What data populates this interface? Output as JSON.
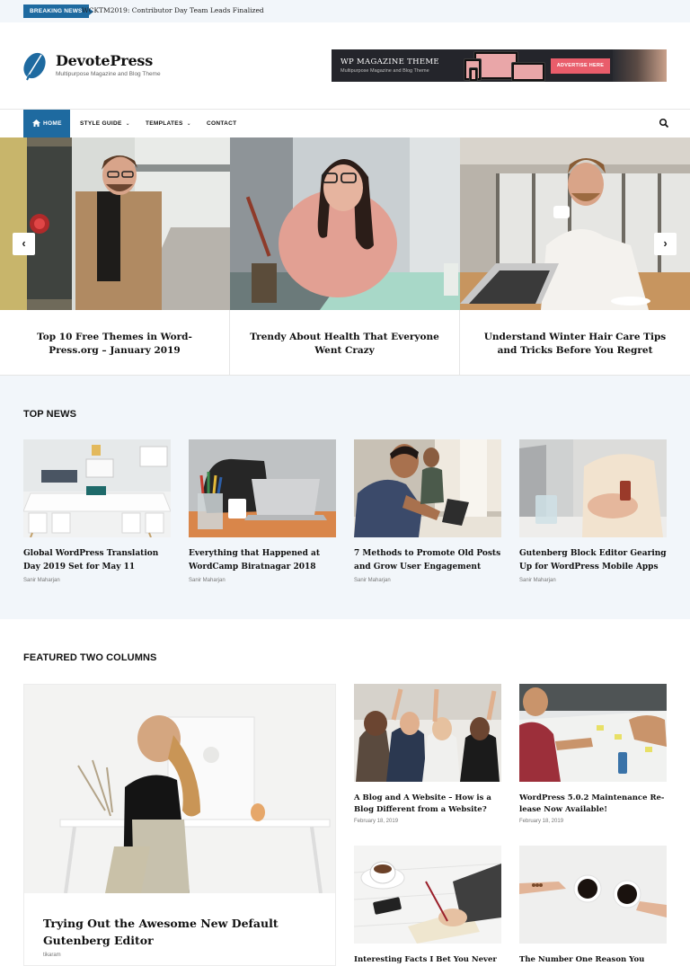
{
  "breaking": {
    "badge": "BREAKING NEWS",
    "text": "WCKTM2019: Contributor Day Team Leads Finalized"
  },
  "site": {
    "title": "DevotePress",
    "tagline": "Multipurpose Magazine and Blog Theme"
  },
  "ad": {
    "title": "WP MAGAZINE THEME",
    "subtitle": "Multipurpose Magazine and Blog Theme",
    "button": "ADVERTISE HERE"
  },
  "nav": {
    "home": "HOME",
    "style_guide": "STYLE GUIDE",
    "templates": "TEMPLATES",
    "contact": "CONTACT",
    "dropdown_glyph": "⌄"
  },
  "slider": {
    "prev": "‹",
    "next": "›",
    "slides": [
      {
        "title": "Top 10 Free Themes in Word-Press.org – January 2019"
      },
      {
        "title": "Trendy About Health That Everyone Went Crazy"
      },
      {
        "title": "Understand Winter Hair Care Tips and Tricks Before You Regret"
      }
    ]
  },
  "top_news": {
    "heading": "TOP NEWS",
    "items": [
      {
        "title": "Global WordPress Translation Day 2019 Set for May 11",
        "author": "Sanir Maharjan"
      },
      {
        "title": "Everything that Happened at WordCamp Biratnagar 2018",
        "author": "Sanir Maharjan"
      },
      {
        "title": "7 Methods to Promote Old Posts and Grow User Engagement",
        "author": "Sanir Maharjan"
      },
      {
        "title": "Gutenberg Block Editor Gearing Up for WordPress Mobile Apps",
        "author": "Sanir Maharjan"
      }
    ]
  },
  "featured": {
    "heading": "FEATURED TWO COLUMNS",
    "main": {
      "title": "Trying Out the Awesome New Default Gutenberg Editor",
      "author": "tikaram"
    },
    "items": [
      {
        "title": "A Blog and A Website – How is a Blog Different from a Website?",
        "date": "February 18, 2019"
      },
      {
        "title": "WordPress 5.0.2 Maintenance Re-lease Now Available!",
        "date": "February 18, 2019"
      },
      {
        "title": "Interesting Facts I Bet You Never",
        "date": ""
      },
      {
        "title": "The Number One Reason You",
        "date": ""
      }
    ]
  },
  "colors": {
    "accent": "#1e6aa0",
    "section_bg": "#f2f6fa",
    "ad_button": "#e95d6b"
  },
  "icons": [
    "logo-leaf-icon",
    "home-icon",
    "chevron-down-icon",
    "search-icon",
    "arrow-left-icon",
    "arrow-right-icon"
  ]
}
